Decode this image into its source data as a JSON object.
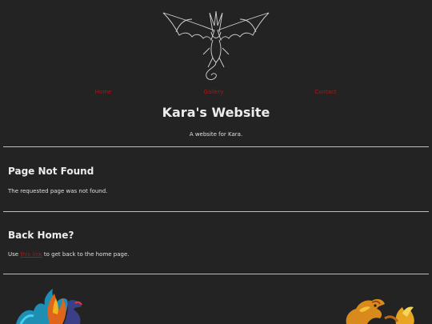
{
  "nav": {
    "home": "Home",
    "gallery": "Gallery",
    "contact": "Contact"
  },
  "site": {
    "title": "Kara's Website",
    "tagline": "A website for Kara."
  },
  "sections": [
    {
      "heading": "Page Not Found",
      "text": "The requested page was not found."
    },
    {
      "heading": "Back Home?",
      "text_before": "Use ",
      "link": "this link",
      "text_after": " to get back to the home page."
    }
  ],
  "colors": {
    "background": "#232323",
    "link": "#b3140f",
    "text": "#e6e6e6"
  },
  "icons": {
    "logo": "winged-dragon-line-art",
    "left_art": "fire-ice-dragon",
    "right_art": "golden-eastern-dragon"
  }
}
